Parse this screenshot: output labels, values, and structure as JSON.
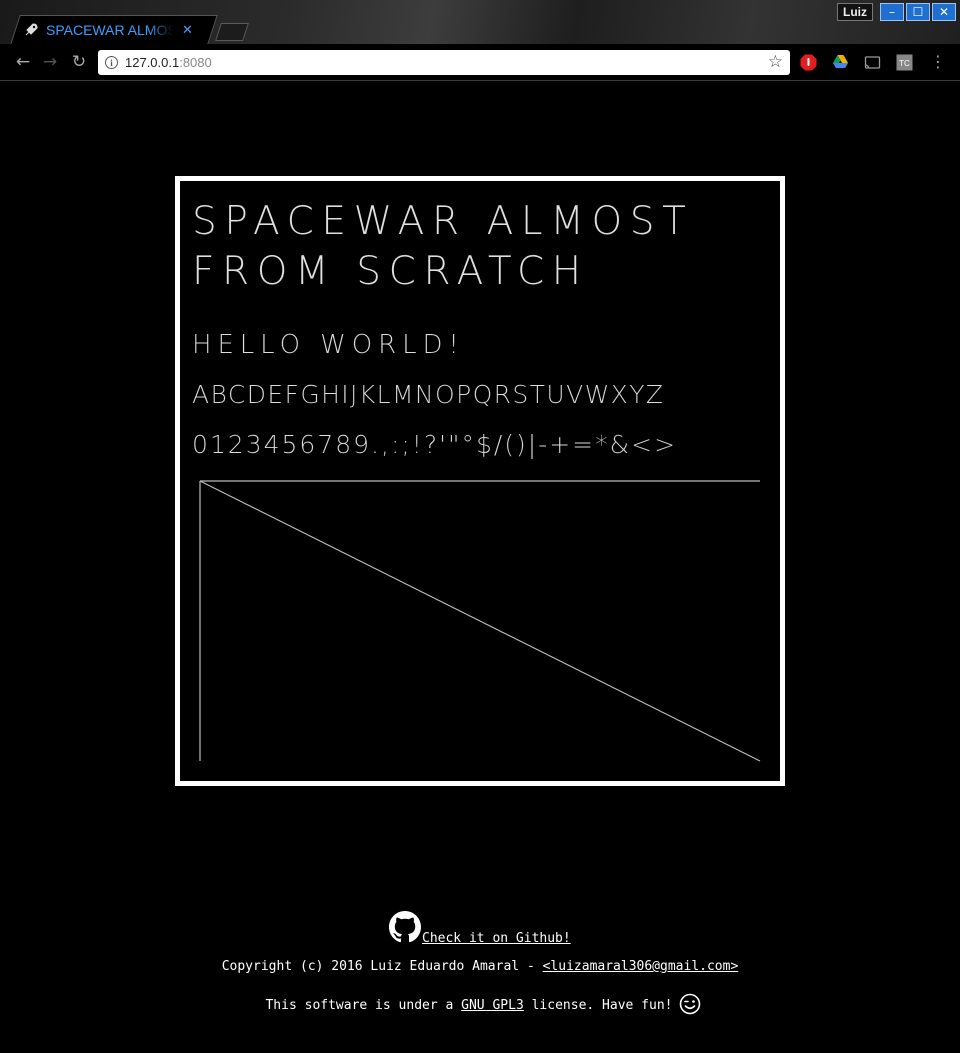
{
  "browser": {
    "tab": {
      "title": "SPACEWAR ALMOST FROM SCRATCH",
      "close_glyph": "✕"
    },
    "profile_name": "Luiz",
    "window_controls": {
      "minimize": "–",
      "maximize": "☐",
      "close": "✕"
    },
    "nav": {
      "back": "←",
      "forward": "→",
      "reload": "↻"
    },
    "address": {
      "host": "127.0.0.1",
      "port": ":8080"
    },
    "star_glyph": "☆",
    "menu_glyph": "⋮",
    "extensions": [
      "adblock-icon",
      "google-drive-icon",
      "cast-icon",
      "tc-extension-icon"
    ],
    "accent_color": "#3aa0ff"
  },
  "game": {
    "title_line1": "SPACEWAR ALMOST",
    "title_line2": "FROM SCRATCH",
    "hello": "HELLO WORLD!",
    "alphabet": "ABCDEFGHIJKLMNOPQRSTUVWXYZ",
    "numbers": "0123456789.,:;!?'\"°$/()|-+=*&<>"
  },
  "footer": {
    "github_text": "Check it on Github!",
    "copyright_prefix": "Copyright (c) 2016 Luiz Eduardo Amaral - ",
    "email": "<luizamaral306@gmail.com>",
    "license_prefix": "This software is under a ",
    "license_link": "GNU GPL3",
    "license_suffix": " license. Have fun!"
  }
}
